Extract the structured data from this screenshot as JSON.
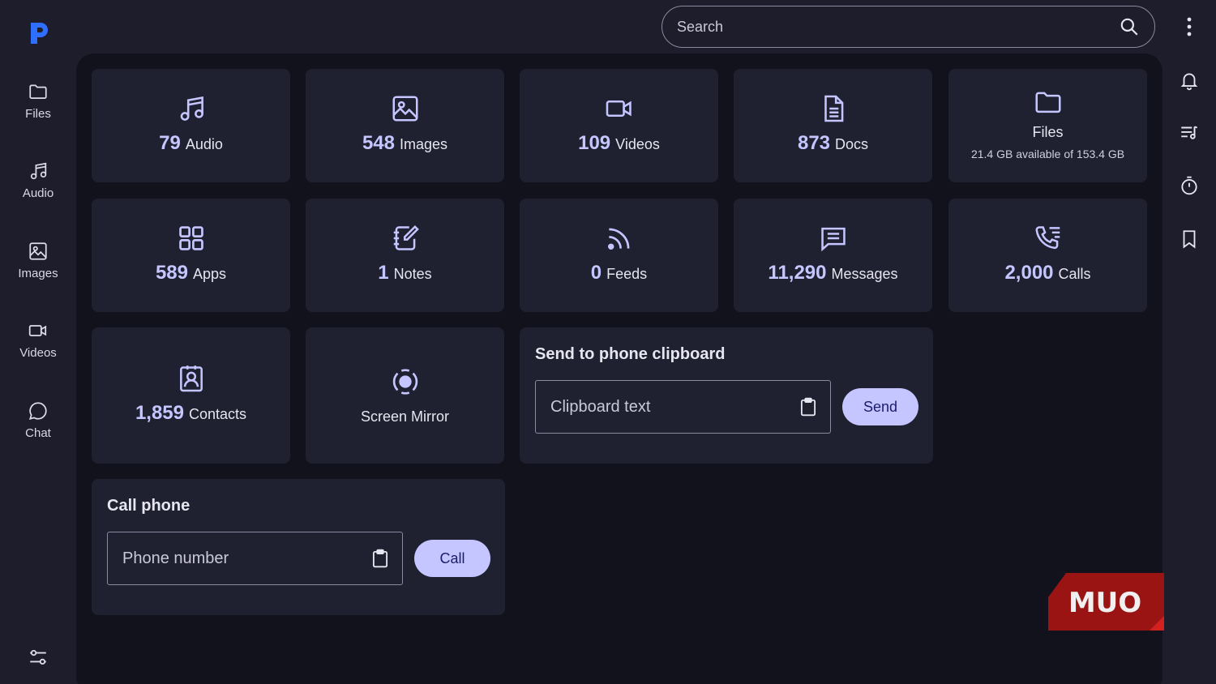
{
  "app": {
    "logo_letter": "P",
    "accent": "#c5c6ff",
    "logo_color": "#2f6fff"
  },
  "search": {
    "placeholder": "Search"
  },
  "sidebar": {
    "items": [
      {
        "label": "Files",
        "icon": "folder-icon"
      },
      {
        "label": "Audio",
        "icon": "music-note-icon"
      },
      {
        "label": "Images",
        "icon": "image-icon"
      },
      {
        "label": "Videos",
        "icon": "video-camera-icon"
      },
      {
        "label": "Chat",
        "icon": "chat-bubble-icon"
      }
    ]
  },
  "right_rail": [
    "bell-icon",
    "playlist-icon",
    "timer-icon",
    "bookmark-icon"
  ],
  "stats": {
    "audio": {
      "count": "79",
      "label": "Audio"
    },
    "images": {
      "count": "548",
      "label": "Images"
    },
    "videos": {
      "count": "109",
      "label": "Videos"
    },
    "docs": {
      "count": "873",
      "label": "Docs"
    },
    "files": {
      "label": "Files",
      "storage": "21.4 GB available of 153.4 GB"
    },
    "apps": {
      "count": "589",
      "label": "Apps"
    },
    "notes": {
      "count": "1",
      "label": "Notes"
    },
    "feeds": {
      "count": "0",
      "label": "Feeds"
    },
    "messages": {
      "count": "11,290",
      "label": "Messages"
    },
    "calls": {
      "count": "2,000",
      "label": "Calls"
    },
    "contacts": {
      "count": "1,859",
      "label": "Contacts"
    },
    "mirror": {
      "label": "Screen Mirror"
    }
  },
  "clipboard": {
    "title": "Send to phone clipboard",
    "placeholder": "Clipboard text",
    "button": "Send"
  },
  "call": {
    "title": "Call phone",
    "placeholder": "Phone number",
    "button": "Call"
  },
  "watermark": {
    "text": "MUO"
  }
}
